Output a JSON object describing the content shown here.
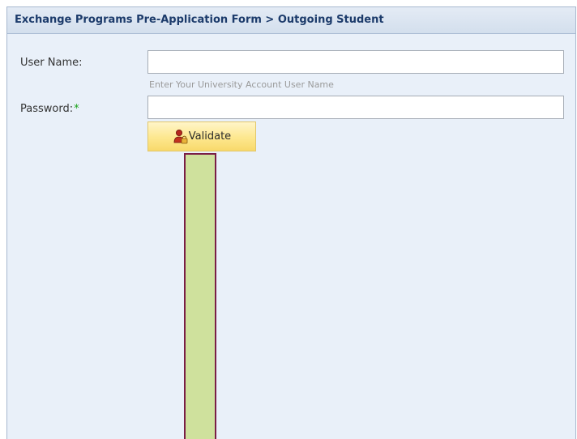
{
  "header": {
    "title": "Exchange Programs Pre-Application Form > Outgoing Student"
  },
  "form": {
    "username": {
      "label": "User Name:",
      "value": "",
      "hint": "Enter Your University Account User Name"
    },
    "password": {
      "label": "Password:",
      "required_marker": "*",
      "value": ""
    },
    "validate_button": {
      "label": "Validate",
      "icon": "user-lock-icon"
    }
  },
  "colors": {
    "panel_background": "#e9f0f9",
    "header_text": "#1c3b6b",
    "required_marker": "#1aa31a",
    "button_background": "#fde78e",
    "overlay_bar_fill": "#cfe19d",
    "overlay_bar_border": "#7a1e46"
  }
}
